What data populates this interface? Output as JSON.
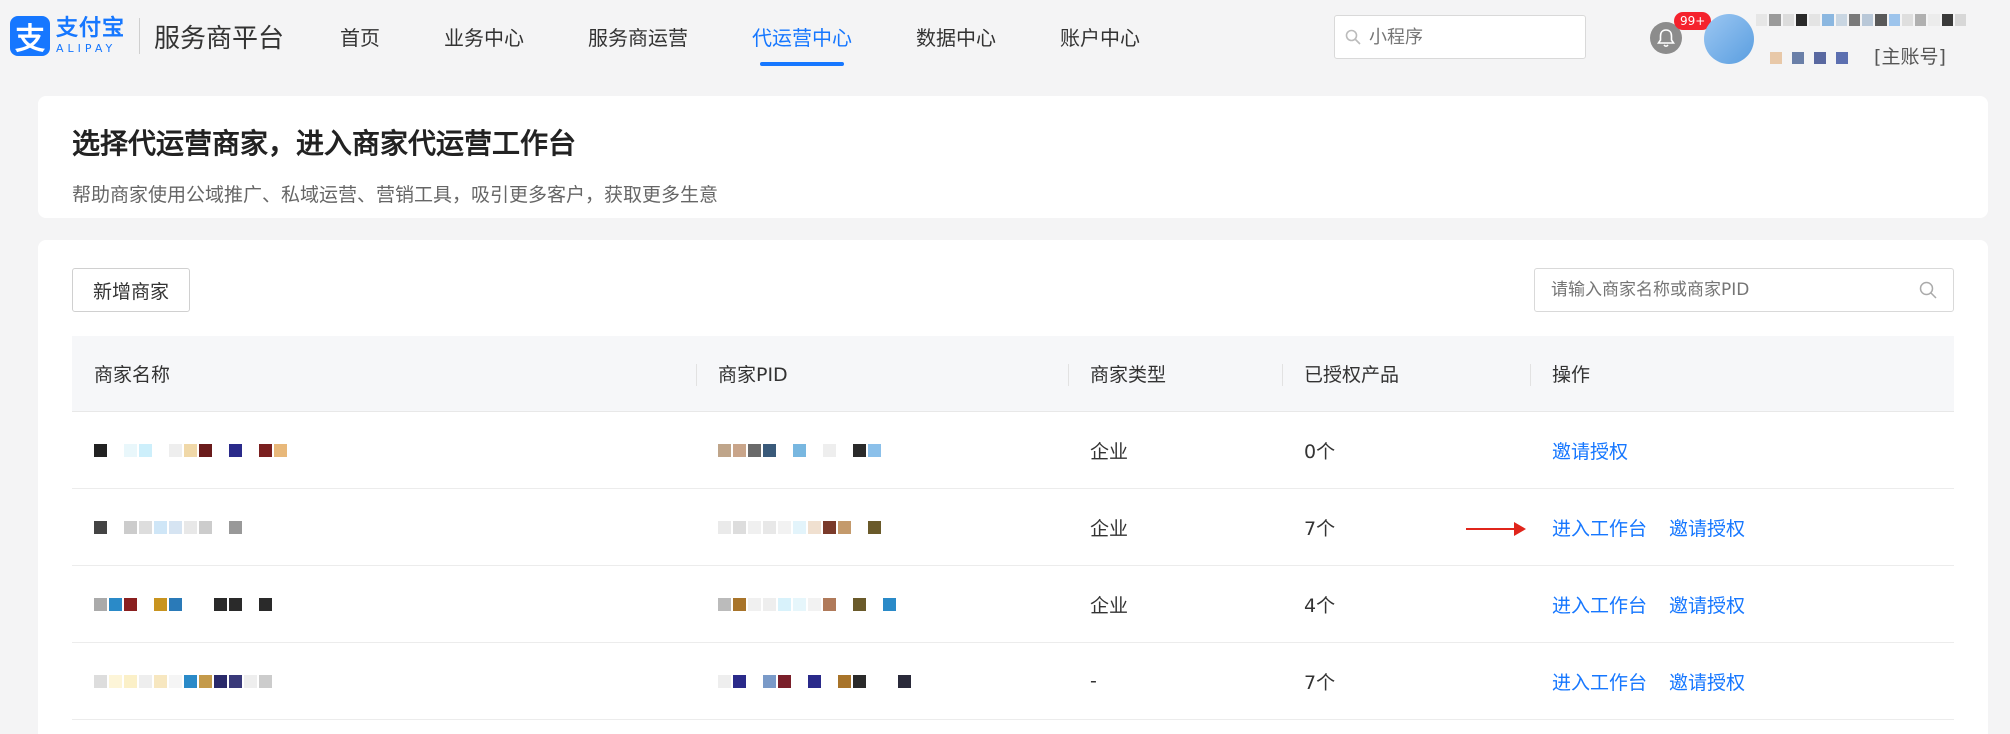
{
  "header": {
    "logo_cn": "支付宝",
    "logo_en": "ALIPAY",
    "platform": "服务商平台",
    "nav": [
      {
        "label": "首页",
        "active": false
      },
      {
        "label": "业务中心",
        "active": false
      },
      {
        "label": "服务商运营",
        "active": false
      },
      {
        "label": "代运营中心",
        "active": true
      },
      {
        "label": "数据中心",
        "active": false
      },
      {
        "label": "账户中心",
        "active": false
      }
    ],
    "search_placeholder": "小程序",
    "badge": "99+",
    "account_role": "[主账号]"
  },
  "intro": {
    "title": "选择代运营商家，进入商家代运营工作台",
    "desc": "帮助商家使用公域推广、私域运营、营销工具，吸引更多客户，获取更多生意"
  },
  "list": {
    "add_button": "新增商家",
    "search_placeholder": "请输入商家名称或商家PID",
    "columns": [
      "商家名称",
      "商家PID",
      "商家类型",
      "已授权产品",
      "操作"
    ],
    "rows": [
      {
        "type": "企业",
        "products": "0个",
        "actions": [
          "邀请授权"
        ]
      },
      {
        "type": "企业",
        "products": "7个",
        "actions": [
          "进入工作台",
          "邀请授权"
        ]
      },
      {
        "type": "企业",
        "products": "4个",
        "actions": [
          "进入工作台",
          "邀请授权"
        ]
      },
      {
        "type": "-",
        "products": "7个",
        "actions": [
          "进入工作台",
          "邀请授权"
        ]
      }
    ]
  },
  "colors": {
    "accent": "#1677ff",
    "arrow": "#e0251b",
    "badge": "#f5222d"
  }
}
